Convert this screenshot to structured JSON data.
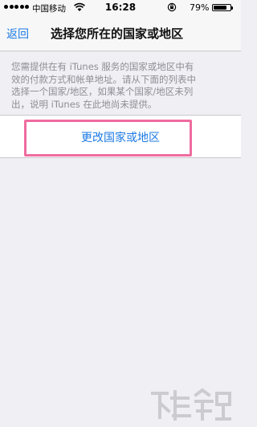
{
  "status_bar": {
    "carrier": "中国移动",
    "time": "16:28",
    "battery_percent": "79%",
    "battery_level": 0.79,
    "icons": [
      "signal-dots-icon",
      "wifi-icon",
      "orientation-lock-icon",
      "battery-icon"
    ]
  },
  "nav": {
    "back_label": "返回",
    "title": "选择您所在的国家或地区"
  },
  "description": {
    "lines": [
      "您需提供在有 iTunes 服务的国家或地区中有",
      "效的付款方式和帐单地址。请从下面的列表中",
      "选择一个国家/地区，如果某个国家/地区未列",
      "出，说明 iTunes 在此地尚未提供。"
    ]
  },
  "action": {
    "change_label": "更改国家或地区"
  },
  "colors": {
    "accent": "#1c7ae4",
    "background": "#efeff4",
    "highlight": "#f06b9f"
  }
}
